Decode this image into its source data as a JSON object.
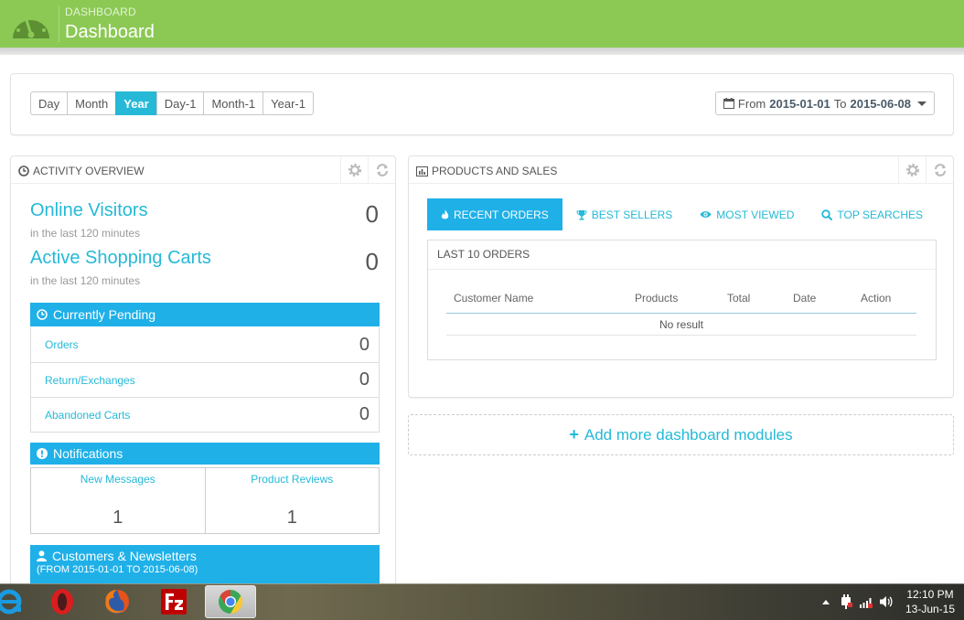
{
  "header": {
    "breadcrumb": "DASHBOARD",
    "title": "Dashboard",
    "color": "#8bc954"
  },
  "range": {
    "periods": [
      "Day",
      "Month",
      "Year",
      "Day-1",
      "Month-1",
      "Year-1"
    ],
    "active_period": "Year",
    "from_label": "From",
    "from_date": "2015-01-01",
    "to_label": "To",
    "to_date": "2015-06-08"
  },
  "activity": {
    "title": "Activity overview",
    "online_visitors": {
      "label": "Online Visitors",
      "sub": "in the last 120 minutes",
      "value": "0"
    },
    "active_carts": {
      "label": "Active Shopping Carts",
      "sub": "in the last 120 minutes",
      "value": "0"
    },
    "pending": {
      "title": "Currently Pending",
      "rows": [
        {
          "label": "Orders",
          "value": "0"
        },
        {
          "label": "Return/Exchanges",
          "value": "0"
        },
        {
          "label": "Abandoned Carts",
          "value": "0"
        }
      ]
    },
    "notifications": {
      "title": "Notifications",
      "cells": [
        {
          "label": "New Messages",
          "value": "1"
        },
        {
          "label": "Product Reviews",
          "value": "1"
        }
      ]
    },
    "customers": {
      "title": "Customers & Newsletters",
      "range": "(FROM 2015-01-01 TO 2015-06-08)"
    }
  },
  "products": {
    "title": "Products and Sales",
    "tabs": [
      "Recent Orders",
      "Best Sellers",
      "Most Viewed",
      "Top Searches"
    ],
    "active_tab": "Recent Orders",
    "orders_title": "Last 10 Orders",
    "columns": [
      "Customer Name",
      "Products",
      "Total",
      "Date",
      "Action"
    ],
    "empty": "No result"
  },
  "add_modules": "Add more dashboard modules",
  "accent_color": "#25b9d7",
  "taskbar": {
    "apps": [
      "internet-explorer",
      "opera",
      "firefox",
      "filezilla",
      "chrome"
    ],
    "active_app": "chrome",
    "time": "12:10 PM",
    "date": "13-Jun-15"
  }
}
